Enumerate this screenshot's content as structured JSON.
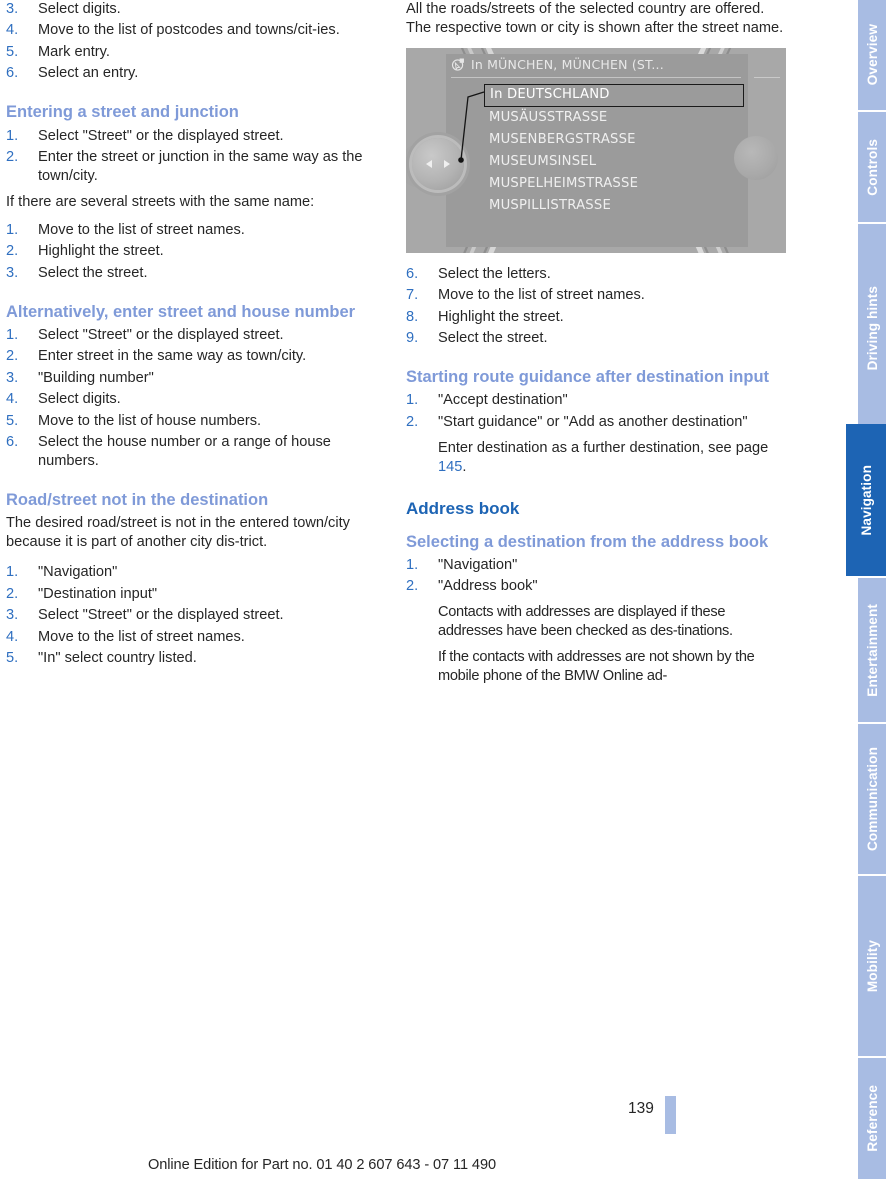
{
  "document": {
    "page_number": "139",
    "footer_note": "Online Edition for Part no. 01 40 2 607 643 - 07 11 490",
    "colors": {
      "heading_primary": "#1d64b4",
      "heading_secondary": "#7f9ad8",
      "list_number": "#2f6fc0",
      "tab_inactive": "#a8bce3",
      "tab_active": "#1d64b4",
      "body_text": "#262626"
    }
  },
  "left_column": {
    "continued_list": {
      "items": [
        {
          "num": "3.",
          "text": "Select digits."
        },
        {
          "num": "4.",
          "text": "Move to the list of postcodes and towns/cit-ies."
        },
        {
          "num": "5.",
          "text": "Mark entry."
        },
        {
          "num": "6.",
          "text": "Select an entry."
        }
      ]
    },
    "section_street_junction": {
      "heading": "Entering a street and junction",
      "items": [
        {
          "num": "1.",
          "text": "Select \"Street\" or the displayed street."
        },
        {
          "num": "2.",
          "text": "Enter the street or junction in the same way as the town/city."
        }
      ],
      "note": "If there are several streets with the same name:",
      "items2": [
        {
          "num": "1.",
          "text": "Move to the list of street names."
        },
        {
          "num": "2.",
          "text": "Highlight the street."
        },
        {
          "num": "3.",
          "text": "Select the street."
        }
      ]
    },
    "section_house_number": {
      "heading": "Alternatively, enter street and house number",
      "items": [
        {
          "num": "1.",
          "text": "Select \"Street\" or the displayed street."
        },
        {
          "num": "2.",
          "text": "Enter street in the same way as town/city."
        },
        {
          "num": "3.",
          "text": "\"Building number\""
        },
        {
          "num": "4.",
          "text": "Select digits."
        },
        {
          "num": "5.",
          "text": "Move to the list of house numbers."
        },
        {
          "num": "6.",
          "text": "Select the house number or a range of house numbers."
        }
      ]
    },
    "section_road_not_in_destination": {
      "heading": "Road/street not in the destination",
      "paragraph": "The desired road/street is not in the entered town/city because it is part of another city dis-trict.",
      "items": [
        {
          "num": "1.",
          "text": "\"Navigation\""
        },
        {
          "num": "2.",
          "text": "\"Destination input\""
        },
        {
          "num": "3.",
          "text": "Select \"Street\" or the displayed street."
        },
        {
          "num": "4.",
          "text": "Move to the list of street names."
        },
        {
          "num": "5.",
          "text": "\"In\" select country listed."
        }
      ]
    }
  },
  "right_column": {
    "intro_paragraph": "All the roads/streets of the selected country are offered. The respective town or city is shown after the street name.",
    "figure": {
      "name": "navigation-street-list-screen",
      "header_icon": "navigation-arrow-icon",
      "header_text": "In MÜNCHEN, MÜNCHEN (ST...",
      "list": [
        "In DEUTSCHLAND",
        "MUSÄUSSTRASSE",
        "MUSENBERGSTRASSE",
        "MUSEUMSINSEL",
        "MUSPELHEIMSTRASSE",
        "MUSPILLISTRASSE"
      ],
      "selected_index": 0,
      "left_knob": "controller-left-right-arrows",
      "right_knob": "rotary-knob"
    },
    "continued_list": {
      "items": [
        {
          "num": "6.",
          "text": "Select the letters."
        },
        {
          "num": "7.",
          "text": "Move to the list of street names."
        },
        {
          "num": "8.",
          "text": "Highlight the street."
        },
        {
          "num": "9.",
          "text": "Select the street."
        }
      ]
    },
    "section_route_guidance": {
      "heading": "Starting route guidance after destination input",
      "items": [
        {
          "num": "1.",
          "text": "\"Accept destination\"",
          "sub": ""
        },
        {
          "num": "2.",
          "text": "\"Start guidance\" or \"Add as another destination\"",
          "sub_pre": "Enter destination as a further destination, see page ",
          "sub_ref": "145",
          "sub_post": "."
        }
      ]
    },
    "section_address_book": {
      "heading": "Address book",
      "subheading": "Selecting a destination from the address book",
      "items": [
        {
          "num": "1.",
          "text": "\"Navigation\""
        },
        {
          "num": "2.",
          "text": "\"Address book\""
        }
      ],
      "sub_paragraph_1": "Contacts with addresses are displayed if these addresses have been checked as des-tinations.",
      "sub_paragraph_2": "If the contacts with addresses are not shown by the mobile phone of the BMW Online ad-"
    }
  },
  "sidebar": {
    "tabs": [
      {
        "label": "Overview",
        "active": false
      },
      {
        "label": "Controls",
        "active": false
      },
      {
        "label": "Driving hints",
        "active": false
      },
      {
        "label": "Navigation",
        "active": true
      },
      {
        "label": "Entertainment",
        "active": false
      },
      {
        "label": "Communication",
        "active": false
      },
      {
        "label": "Mobility",
        "active": false
      },
      {
        "label": "Reference",
        "active": false
      }
    ]
  }
}
